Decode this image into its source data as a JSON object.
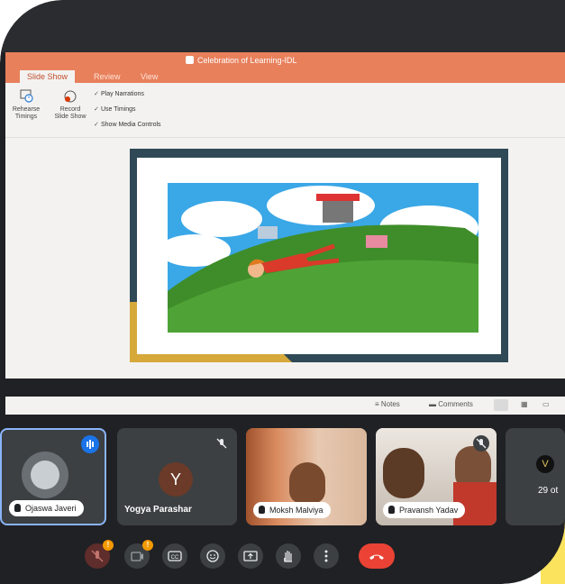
{
  "presentation": {
    "window_title": "Celebration of Learning-IDL",
    "tabs": [
      {
        "label": "Slide Show",
        "active": true
      },
      {
        "label": "Review",
        "active": false
      },
      {
        "label": "View",
        "active": false
      }
    ],
    "ribbon": {
      "rehearse_line1": "Rehearse",
      "rehearse_line2": "Timings",
      "record_line1": "Record",
      "record_line2": "Slide Show",
      "checkboxes": [
        {
          "label": "Play Narrations",
          "checked": true
        },
        {
          "label": "Use Timings",
          "checked": true
        },
        {
          "label": "Show Media Controls",
          "checked": true
        }
      ]
    },
    "status_bar": {
      "notes_label": "Notes",
      "comments_label": "Comments"
    }
  },
  "participants": [
    {
      "name": "Ojaswa Javeri",
      "speaking": true
    },
    {
      "name": "Yogya Parashar",
      "avatar_letter": "Y",
      "muted": true
    },
    {
      "name": "Moksh Malviya"
    },
    {
      "name": "Pravansh Yadav",
      "muted": true
    },
    {
      "overflow_text": "29 ot"
    }
  ],
  "colors": {
    "ppt_accent": "#e8805c",
    "meet_bg": "#202124",
    "active_border": "#8ab4f8",
    "end_call": "#ea4335",
    "warning": "#f29900",
    "yellow_band": "#fbe35e"
  }
}
